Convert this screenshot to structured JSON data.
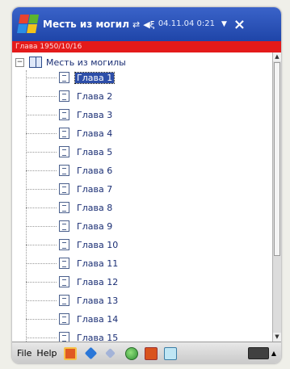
{
  "window": {
    "title": "Месть из могил",
    "clock": "04.11.04 0:21",
    "close": "×"
  },
  "header_bar": {
    "text": "Глава  1950/10/16"
  },
  "tree": {
    "root_label": "Месть из могилы",
    "chapters": [
      {
        "label": "Глава 1",
        "selected": true
      },
      {
        "label": "Глава 2"
      },
      {
        "label": "Глава 3"
      },
      {
        "label": "Глава 4"
      },
      {
        "label": "Глава 5"
      },
      {
        "label": "Глава 6"
      },
      {
        "label": "Глава 7"
      },
      {
        "label": "Глава 8"
      },
      {
        "label": "Глава 9"
      },
      {
        "label": "Глава 10"
      },
      {
        "label": "Глава 11"
      },
      {
        "label": "Глава 12"
      },
      {
        "label": "Глава 13"
      },
      {
        "label": "Глава 14"
      },
      {
        "label": "Глава 15"
      }
    ]
  },
  "taskbar": {
    "menu": [
      "File",
      "Help"
    ],
    "icons": [
      "cards-icon",
      "diamond-icon",
      "gem-icon",
      "globe-icon",
      "camera-icon",
      "document-icon",
      "keyboard-icon"
    ]
  },
  "colors": {
    "titlebar": "#2a52be",
    "redbar": "#e41a1a",
    "selection": "#2d4ea8"
  }
}
